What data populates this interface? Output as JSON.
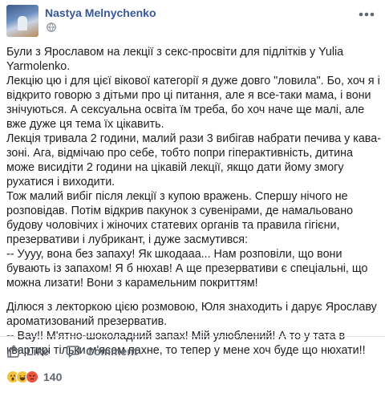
{
  "post": {
    "author": "Nastya Melnychenko",
    "privacy_icon": "globe-icon",
    "menu_icon": "more-options-icon",
    "paragraphs": [
      "Були з Ярославом на лекції з секс-просвіти для підлітків у Yulia Yarmolenko.",
      "Лекцію цю і для цієї вікової категорії я дуже довго \"ловила\". Бо, хоч я і відкрито говорю з дітьми про ці питання, але я все-таки мама, і вони знічуються. А сексуальна освіта їм треба, бо хоч наче ще малі, але вже дуже ця тема їх цікавить.",
      "Лекція тривала 2 години, малий рази 3 вибігав набрати печива у кава-зоні. Ага, відмічаю про себе, тобто попри гіперактивність, дитина може висидіти 2 години на цікавій лекції, якщо дати йому змогу рухатися і виходити.",
      "Тож малий вибіг після лекції з купою вражень. Спершу нічого не розповідав. Потім відкрив пакунок з сувенірами, де намальовано будову чоловічих і жіночих статевих органів та правила гігієни, презервативи і лубрикант, і дуже засмутився:",
      "-- Уууу, вона без запаху! Як шкодааа... Нам розповіли, що вони бувають із запахом! Я б нюхав! А ще презервативи є спеціальні, що можна лизати! Вони з карамельним покриттям!",
      "Ділюся з лекторкою цією розмовою, Юля знаходить і дарує Ярославу ароматизований презерватив.",
      "-- Вау!! М'ятно-шоколадний запах! Мій улюблений! А то у тата в квартирі тільки м'ясом пахне, то тепер у мене хоч буде що нюхати!!"
    ]
  },
  "actions": {
    "like_label": "Like",
    "comment_label": "Comment"
  },
  "reactions": {
    "count": "140",
    "types": [
      "wow",
      "haha",
      "angry"
    ]
  }
}
